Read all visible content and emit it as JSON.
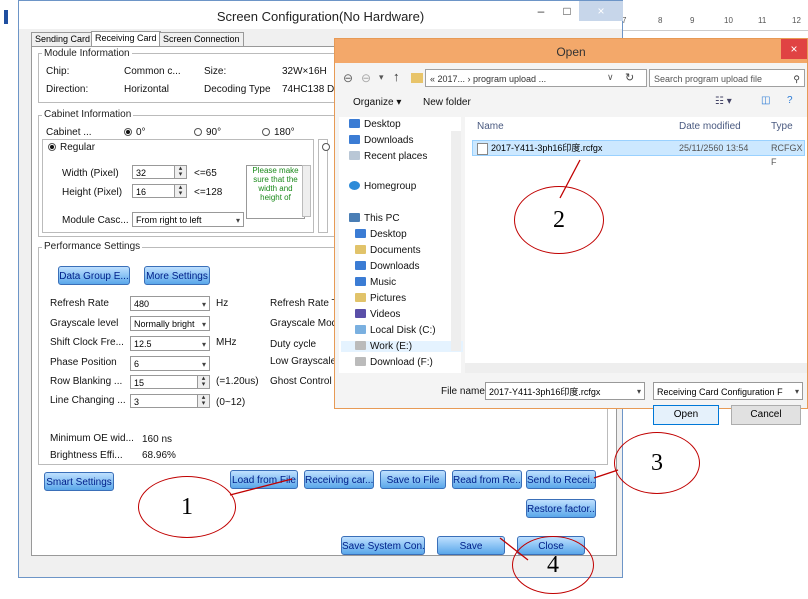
{
  "ruler": {
    "marks": [
      "7",
      "8",
      "9",
      "10",
      "11",
      "12"
    ]
  },
  "window": {
    "title": "Screen Configuration(No Hardware)",
    "minimize": "–",
    "maximize": "□",
    "close": "×",
    "tabs": [
      "Sending Card",
      "Receiving Card",
      "Screen Connection"
    ]
  },
  "module_info": {
    "title": "Module Information",
    "chip_label": "Chip:",
    "chip_value": "Common c...",
    "size_label": "Size:",
    "size_value": "32W×16H",
    "direction_label": "Direction:",
    "direction_value": "Horizontal",
    "decoding_label": "Decoding Type",
    "decoding_value": "74HC138 D"
  },
  "cabinet": {
    "title": "Cabinet Information",
    "cabinet_label": "Cabinet ...",
    "rotations": [
      "0°",
      "90°",
      "180°"
    ],
    "regular_label": "Regular",
    "width_label": "Width (Pixel)",
    "width_value": "32",
    "width_hint": "<=65",
    "height_label": "Height (Pixel)",
    "height_value": "16",
    "height_hint": "<=128",
    "note": "Please make sure that the width and height of",
    "cascade_label": "Module Casc...",
    "cascade_value": "From right to left"
  },
  "performance": {
    "title": "Performance Settings",
    "data_group_button": "Data Group E...",
    "more_settings_button": "More Settings",
    "refresh_rate_label": "Refresh Rate",
    "refresh_rate_value": "480",
    "refresh_rate_unit": "Hz",
    "refresh_rate_right": "Refresh Rate T",
    "grayscale_label": "Grayscale level",
    "grayscale_value": "Normally bright",
    "grayscale_right": "Grayscale Mod",
    "shift_clock_label": "Shift Clock Fre...",
    "shift_clock_value": "12.5",
    "shift_clock_unit": "MHz",
    "duty_cycle_label": "Duty cycle",
    "phase_label": "Phase Position",
    "phase_value": "6",
    "low_grayscale_label": "Low Grayscale",
    "row_blanking_label": "Row Blanking ...",
    "row_blanking_value": "15",
    "row_blanking_hint": "(=1.20us)",
    "ghost_control_label": "Ghost Control",
    "line_changing_label": "Line Changing ...",
    "line_changing_value": "3",
    "line_changing_hint": "(0~12)",
    "min_oe_label": "Minimum OE wid...",
    "min_oe_value": "160 ns",
    "brightness_label": "Brightness Effi...",
    "brightness_value": "68.96%"
  },
  "bottom_buttons": {
    "smart_settings": "Smart Settings",
    "load_from_file": "Load from File",
    "receiving_card": "Receiving car...",
    "save_to_file": "Save to File",
    "read_from": "Read from Re...",
    "send_to_receiver": "Send to Recei...",
    "restore_factory": "Restore factor...",
    "save_system": "Save System Con...",
    "save": "Save",
    "close": "Close"
  },
  "open_dialog": {
    "title": "Open",
    "close": "×",
    "address": "« 2017...  ›  program upload ...",
    "search_placeholder": "Search program upload file",
    "organize": "Organize ▾",
    "new_folder": "New folder",
    "nav_items": [
      "Desktop",
      "Downloads",
      "Recent places",
      "Homegroup",
      "This PC",
      "Desktop",
      "Documents",
      "Downloads",
      "Music",
      "Pictures",
      "Videos",
      "Local Disk (C:)",
      "Work (E:)",
      "Download (F:)"
    ],
    "columns": [
      "Name",
      "Date modified",
      "Type"
    ],
    "file": {
      "name": "2017-Y411-3ph16印度.rcfgx",
      "date": "25/11/2560 13:54",
      "type": "RCFGX F"
    },
    "file_name_label": "File name:",
    "file_name_value": "2017-Y411-3ph16印度.rcfgx",
    "file_type_value": "Receiving Card Configuration F",
    "open_button": "Open",
    "cancel_button": "Cancel"
  },
  "annotations": [
    "1",
    "2",
    "3",
    "4"
  ]
}
